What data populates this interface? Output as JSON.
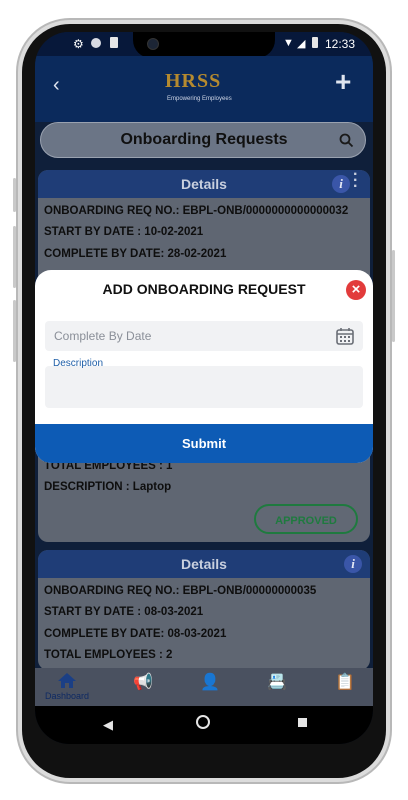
{
  "status_bar": {
    "time": "12:33"
  },
  "header": {
    "logo": "HRSS",
    "tagline": "Empowering Employees"
  },
  "title_bar": {
    "title": "Onboarding Requests"
  },
  "card1": {
    "header": "Details",
    "req_no": "ONBOARDING REQ NO.: EBPL-ONB/0000000000000032",
    "start": "START BY DATE : 10-02-2021",
    "complete": "COMPLETE BY DATE:  28-02-2021",
    "total": "TOTAL EMPLOYEES : 1",
    "desc": "DESCRIPTION : Laptop",
    "status": "APPROVED"
  },
  "card2": {
    "header": "Details",
    "req_no": "ONBOARDING REQ NO.: EBPL-ONB/00000000035",
    "start": "START BY DATE :  08-03-2021",
    "complete": "COMPLETE BY DATE:  08-03-2021",
    "total": "TOTAL EMPLOYEES : 2"
  },
  "modal": {
    "title": "ADD ONBOARDING REQUEST",
    "date_placeholder": "Complete By Date",
    "description_label": "Description",
    "submit": "Submit"
  },
  "bottom_nav": {
    "dashboard": "Dashboard"
  }
}
